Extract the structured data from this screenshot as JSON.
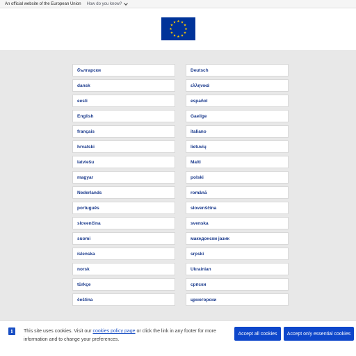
{
  "topbar": {
    "official_text": "An official website of the European Union",
    "how_know_text": "How do you know?"
  },
  "header": {
    "flag_icon": "eu-flag-icon",
    "flag_color": "#003399",
    "star_color": "#ffcc00"
  },
  "languages": [
    "български",
    "Deutsch",
    "dansk",
    "ελληνικά",
    "eesti",
    "español",
    "English",
    "Gaeilge",
    "français",
    "italiano",
    "hrvatski",
    "lietuvių",
    "latviešu",
    "Malti",
    "magyar",
    "polski",
    "Nederlands",
    "română",
    "português",
    "slovenščina",
    "slovenčina",
    "svenska",
    "suomi",
    "македонски јазик",
    "íslenska",
    "srpski",
    "norsk",
    "Ukrainian",
    "türkçe",
    "српски",
    "čeština",
    "црногорски"
  ],
  "cookie": {
    "text_before": "This site uses cookies. Visit our ",
    "link_text": "cookies policy page",
    "text_after": " or click the link in any footer for more information and to change your preferences.",
    "accept_all_label": "Accept all cookies",
    "accept_essential_label": "Accept only essential cookies",
    "info_icon": "info-icon",
    "accent_color": "#0e47cb"
  }
}
